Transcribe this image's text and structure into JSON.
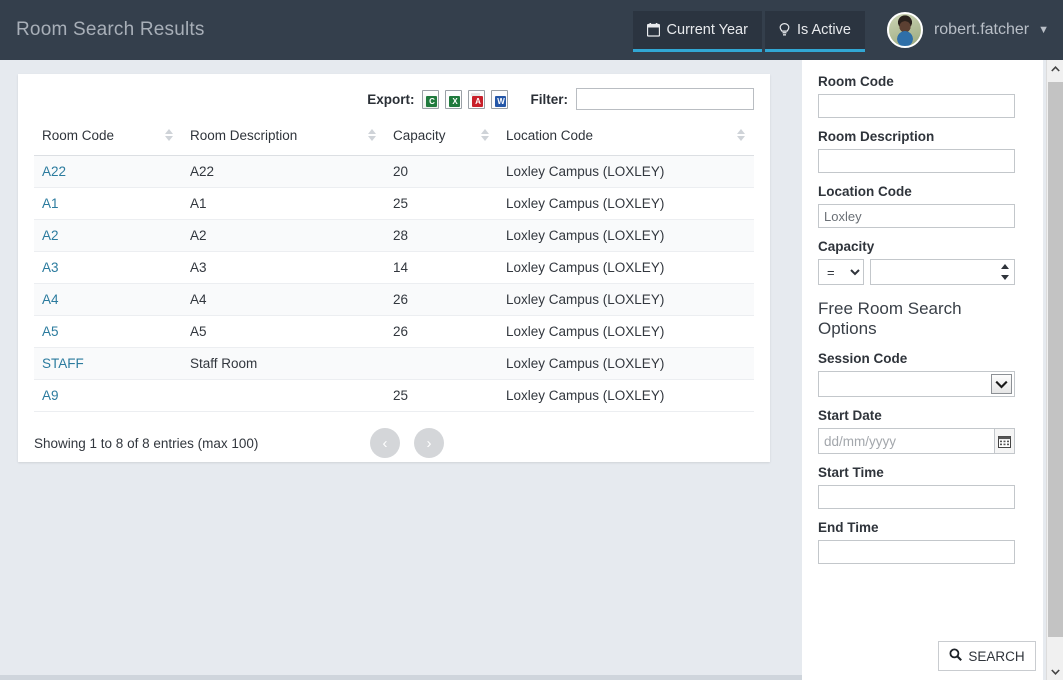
{
  "header": {
    "title": "Room Search Results",
    "context_buttons": [
      {
        "label": "Current Year",
        "icon": "calendar-icon"
      },
      {
        "label": "Is Active",
        "icon": "lightbulb-icon"
      }
    ],
    "user": {
      "name": "robert.fatcher",
      "caret": "▼"
    },
    "underline_color": "#31a7d4",
    "background_color": "#343f4c"
  },
  "toolbar": {
    "export_label": "Export:",
    "export_icons": [
      {
        "name": "export-csv-icon",
        "glyph": "C"
      },
      {
        "name": "export-excel-icon",
        "glyph": "X"
      },
      {
        "name": "export-pdf-icon",
        "glyph": "A"
      },
      {
        "name": "export-word-icon",
        "glyph": "W"
      }
    ],
    "filter_label": "Filter:",
    "filter_value": "",
    "filter_placeholder": ""
  },
  "table": {
    "columns": [
      {
        "label": "Room Code",
        "sortable": true
      },
      {
        "label": "Room Description",
        "sortable": true
      },
      {
        "label": "Capacity",
        "sortable": true
      },
      {
        "label": "Location Code",
        "sortable": true
      }
    ],
    "rows": [
      {
        "code": "A22",
        "description": "A22",
        "capacity": "20",
        "location": "Loxley Campus (LOXLEY)"
      },
      {
        "code": "A1",
        "description": "A1",
        "capacity": "25",
        "location": "Loxley Campus (LOXLEY)"
      },
      {
        "code": "A2",
        "description": "A2",
        "capacity": "28",
        "location": "Loxley Campus (LOXLEY)"
      },
      {
        "code": "A3",
        "description": "A3",
        "capacity": "14",
        "location": "Loxley Campus (LOXLEY)"
      },
      {
        "code": "A4",
        "description": "A4",
        "capacity": "26",
        "location": "Loxley Campus (LOXLEY)"
      },
      {
        "code": "A5",
        "description": "A5",
        "capacity": "26",
        "location": "Loxley Campus (LOXLEY)"
      },
      {
        "code": "STAFF",
        "description": "Staff Room",
        "capacity": "",
        "location": "Loxley Campus (LOXLEY)"
      },
      {
        "code": "A9",
        "description": "",
        "capacity": "25",
        "location": "Loxley Campus (LOXLEY)"
      }
    ],
    "footer_info": "Showing 1 to 8 of 8 entries (max 100)",
    "pagination": {
      "prev": "‹",
      "next": "›"
    },
    "link_color": "#2b7b9e"
  },
  "search_panel": {
    "fields": {
      "room_code": {
        "label": "Room Code",
        "value": "",
        "placeholder": ""
      },
      "room_description": {
        "label": "Room Description",
        "value": "",
        "placeholder": ""
      },
      "location_code": {
        "label": "Location Code",
        "value": "Loxley",
        "placeholder": ""
      },
      "capacity": {
        "label": "Capacity",
        "operator": "=",
        "operator_options": [
          "=",
          ">",
          "<",
          ">=",
          "<="
        ],
        "value": "",
        "placeholder": ""
      }
    },
    "section_heading": "Free Room Search Options",
    "free_fields": {
      "session_code": {
        "label": "Session Code",
        "value": "",
        "options": [
          ""
        ]
      },
      "start_date": {
        "label": "Start Date",
        "value": "",
        "placeholder": "dd/mm/yyyy"
      },
      "start_time": {
        "label": "Start Time",
        "value": "",
        "placeholder": ""
      },
      "end_time": {
        "label": "End Time",
        "value": "",
        "placeholder": ""
      }
    },
    "search_button": {
      "label": "SEARCH",
      "icon": "magnifier-icon"
    }
  },
  "scrollbar": {
    "up": "▲",
    "down": "▼"
  }
}
